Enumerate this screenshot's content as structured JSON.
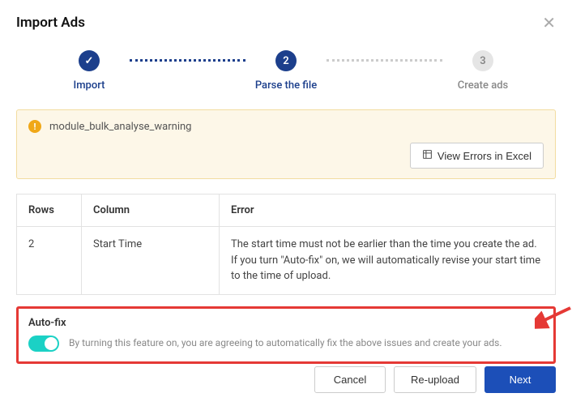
{
  "dialog": {
    "title": "Import Ads"
  },
  "stepper": {
    "step1": {
      "label": "Import"
    },
    "step2": {
      "label": "Parse the file",
      "num": "2"
    },
    "step3": {
      "label": "Create ads",
      "num": "3"
    }
  },
  "warning": {
    "message": "module_bulk_analyse_warning",
    "view_errors_label": "View Errors in Excel"
  },
  "table": {
    "header": {
      "rows": "Rows",
      "column": "Column",
      "error": "Error"
    },
    "rows": [
      {
        "row": "2",
        "column": "Start Time",
        "error": "The start time must not be earlier than the time you create the ad. If you turn \"Auto-fix\" on, we will automatically revise your start time to the time of upload."
      }
    ]
  },
  "autofix": {
    "title": "Auto-fix",
    "description": "By turning this feature on, you are agreeing to automatically fix the above issues and create your ads."
  },
  "footer": {
    "cancel": "Cancel",
    "reupload": "Re-upload",
    "next": "Next"
  }
}
